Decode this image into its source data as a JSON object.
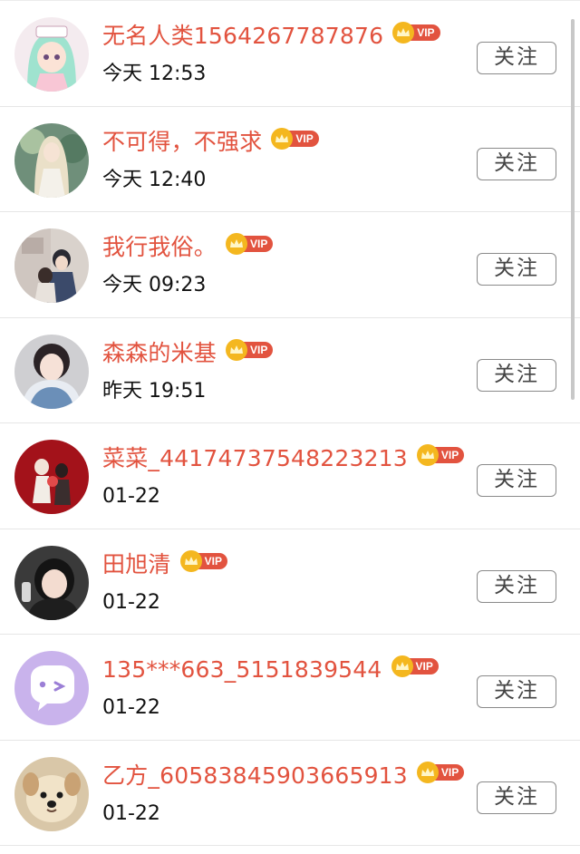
{
  "follow_label": "关注",
  "vip_label": "VIP",
  "colors": {
    "name": "#e2533f",
    "vip_badge": "#e2533f",
    "crown": "#f4b71f"
  },
  "users": [
    {
      "name": "无名人类1564267787876",
      "time": "今天 12:53",
      "avatar": "anime-girl-green-hair"
    },
    {
      "name": "不可得，不强求",
      "time": "今天 12:40",
      "avatar": "girl-white-dress"
    },
    {
      "name": "我行我俗。",
      "time": "今天 09:23",
      "avatar": "couple-illustration"
    },
    {
      "name": "森森的米基",
      "time": "昨天 19:51",
      "avatar": "girl-winter-coat"
    },
    {
      "name": "菜菜_44174737548223213",
      "time": "01-22",
      "avatar": "couple-red-background"
    },
    {
      "name": "田旭清",
      "time": "01-22",
      "avatar": "girl-selfie"
    },
    {
      "name": "135***663_5151839544",
      "time": "01-22",
      "avatar": "default-chat-bubble"
    },
    {
      "name": "乙方_60583845903665913",
      "time": "01-22",
      "avatar": "puppy-photo"
    }
  ]
}
